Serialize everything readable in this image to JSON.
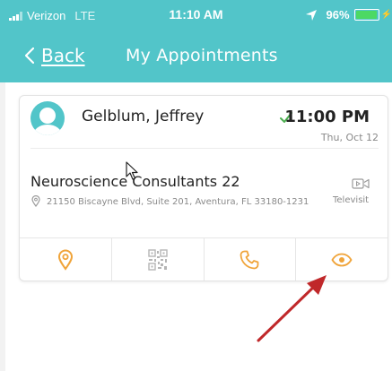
{
  "status_bar": {
    "carrier": "Verizon",
    "network": "LTE",
    "time": "11:10 AM",
    "battery_percent": "96%",
    "battery_level": 0.96,
    "icons": [
      "signal-bars-icon",
      "location-arrow-icon",
      "battery-icon",
      "charging-bolt-icon"
    ]
  },
  "nav": {
    "back_label": "Back",
    "title": "My Appointments"
  },
  "appointment": {
    "provider_name": "Gelblum, Jeffrey",
    "time": "11:00 PM",
    "date": "Thu, Oct 12",
    "status": "confirmed",
    "facility": "Neuroscience Consultants 22",
    "address": "21150 Biscayne Blvd, Suite 201, Aventura, FL 33180-1231",
    "visit_type": "Televisit",
    "actions": [
      "map-pin-icon",
      "qr-code-icon",
      "phone-icon",
      "eye-icon"
    ]
  },
  "colors": {
    "header": "#52c5c9",
    "accent_orange": "#f0a43a",
    "check_green": "#4caf50",
    "annotation_red": "#c0282a"
  }
}
